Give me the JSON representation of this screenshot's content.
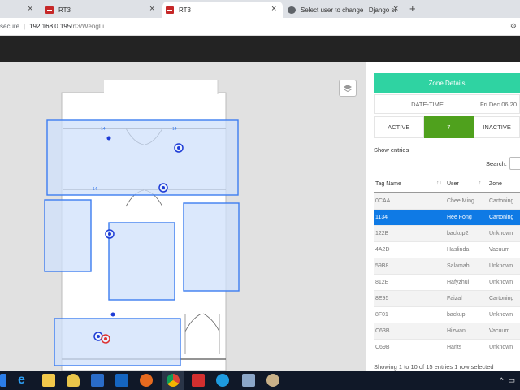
{
  "browser": {
    "tabs": [
      {
        "title": "",
        "icon": "rt3-favicon"
      },
      {
        "title": "RT3",
        "icon": "rt3-favicon"
      },
      {
        "title": "RT3",
        "icon": "rt3-favicon"
      },
      {
        "title": "Select user to change | Django si",
        "icon": "globe-icon"
      }
    ],
    "new_tab": "+",
    "address": {
      "security": "secure",
      "host": "192.168.0.195",
      "path": "/rt3/WengLi"
    }
  },
  "map": {
    "layers_button": "layers-icon",
    "colors": {
      "zone_fill": "#cfe0fb",
      "zone_stroke": "#3d7df0",
      "marker": "#1e3cd6",
      "marker_alert": "#d33"
    }
  },
  "panel": {
    "header": "Zone Details",
    "datetime_label": "DATE-TIME",
    "datetime_value": "Fri Dec 06 20",
    "status": {
      "active": "ACTIVE",
      "count": "7",
      "inactive": "INACTIVE"
    },
    "show_entries": "Show entries",
    "search_label": "Search:",
    "table": {
      "headers": [
        "Tag Name",
        "User",
        "Zone"
      ],
      "rows": [
        {
          "tag": "0CAA",
          "user": "Chee Ming",
          "zone": "Cartoning"
        },
        {
          "tag": "1134",
          "user": "Hee Fong",
          "zone": "Cartoning"
        },
        {
          "tag": "122B",
          "user": "backup2",
          "zone": "Unknown"
        },
        {
          "tag": "4A2D",
          "user": "Haslinda",
          "zone": "Vacuum"
        },
        {
          "tag": "59B8",
          "user": "Salamah",
          "zone": "Unknown"
        },
        {
          "tag": "812E",
          "user": "Hafyzhul",
          "zone": "Unknown"
        },
        {
          "tag": "8E95",
          "user": "Faizal",
          "zone": "Cartoning"
        },
        {
          "tag": "8F01",
          "user": "backup",
          "zone": "Unknown"
        },
        {
          "tag": "C63B",
          "user": "Hizwan",
          "zone": "Vacuum"
        },
        {
          "tag": "C69B",
          "user": "Harits",
          "zone": "Unknown"
        }
      ]
    },
    "footer": "Showing 1 to 10 of 15 entries    1 row selected"
  },
  "taskbar": {
    "colors": {
      "bg": "#101828"
    },
    "apps": [
      "ie-icon",
      "explorer-icon",
      "security-icon",
      "powershell-icon",
      "outlook-icon",
      "firefox-icon",
      "chrome-icon",
      "rt3-icon",
      "skype-icon",
      "app-icon",
      "paint-icon"
    ]
  }
}
